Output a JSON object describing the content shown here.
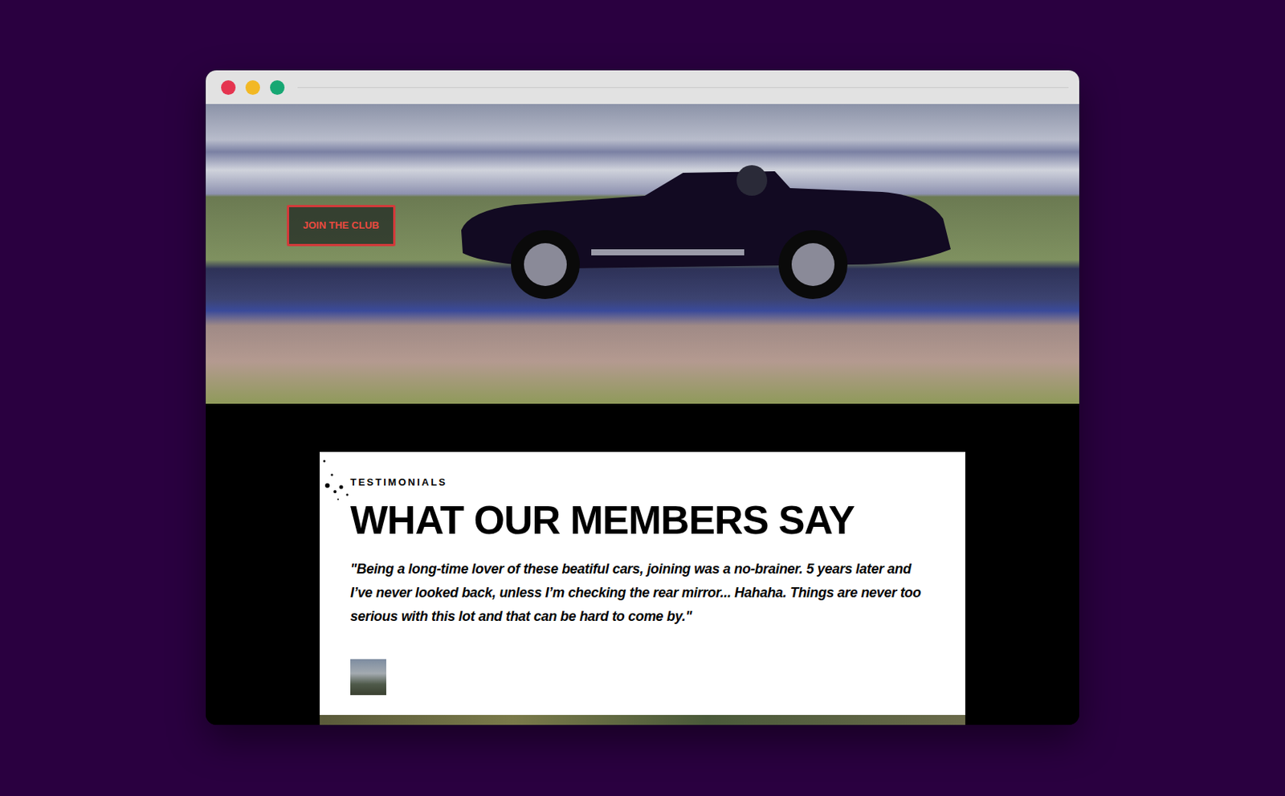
{
  "hero": {
    "button": "JOIN THE CLUB"
  },
  "testimonials": {
    "eyebrow": "TESTIMONIALS",
    "heading": "WHAT OUR MEMBERS SAY",
    "quote": "\"Being a long-time lover of these beatiful cars, joining was a no-brainer. 5 years later and I’ve never looked back, unless I’m checking the rear mirror... Hahaha. Things are never too serious with this lot and that can be hard to come by.\""
  }
}
